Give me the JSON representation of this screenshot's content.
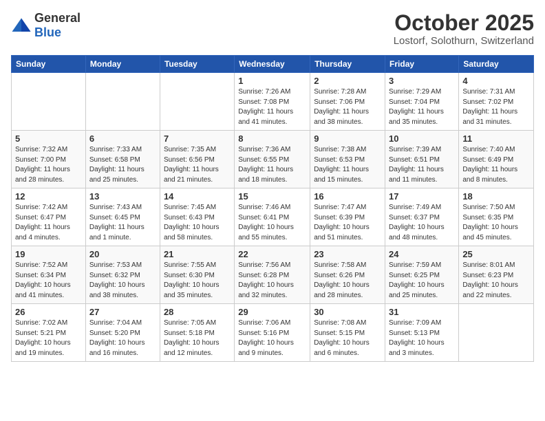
{
  "header": {
    "logo": {
      "general": "General",
      "blue": "Blue"
    },
    "title": "October 2025",
    "location": "Lostorf, Solothurn, Switzerland"
  },
  "weekdays": [
    "Sunday",
    "Monday",
    "Tuesday",
    "Wednesday",
    "Thursday",
    "Friday",
    "Saturday"
  ],
  "weeks": [
    [
      null,
      null,
      null,
      {
        "day": "1",
        "sunrise": "7:26 AM",
        "sunset": "7:08 PM",
        "daylight": "11 hours and 41 minutes."
      },
      {
        "day": "2",
        "sunrise": "7:28 AM",
        "sunset": "7:06 PM",
        "daylight": "11 hours and 38 minutes."
      },
      {
        "day": "3",
        "sunrise": "7:29 AM",
        "sunset": "7:04 PM",
        "daylight": "11 hours and 35 minutes."
      },
      {
        "day": "4",
        "sunrise": "7:31 AM",
        "sunset": "7:02 PM",
        "daylight": "11 hours and 31 minutes."
      }
    ],
    [
      {
        "day": "5",
        "sunrise": "7:32 AM",
        "sunset": "7:00 PM",
        "daylight": "11 hours and 28 minutes."
      },
      {
        "day": "6",
        "sunrise": "7:33 AM",
        "sunset": "6:58 PM",
        "daylight": "11 hours and 25 minutes."
      },
      {
        "day": "7",
        "sunrise": "7:35 AM",
        "sunset": "6:56 PM",
        "daylight": "11 hours and 21 minutes."
      },
      {
        "day": "8",
        "sunrise": "7:36 AM",
        "sunset": "6:55 PM",
        "daylight": "11 hours and 18 minutes."
      },
      {
        "day": "9",
        "sunrise": "7:38 AM",
        "sunset": "6:53 PM",
        "daylight": "11 hours and 15 minutes."
      },
      {
        "day": "10",
        "sunrise": "7:39 AM",
        "sunset": "6:51 PM",
        "daylight": "11 hours and 11 minutes."
      },
      {
        "day": "11",
        "sunrise": "7:40 AM",
        "sunset": "6:49 PM",
        "daylight": "11 hours and 8 minutes."
      }
    ],
    [
      {
        "day": "12",
        "sunrise": "7:42 AM",
        "sunset": "6:47 PM",
        "daylight": "11 hours and 4 minutes."
      },
      {
        "day": "13",
        "sunrise": "7:43 AM",
        "sunset": "6:45 PM",
        "daylight": "11 hours and 1 minute."
      },
      {
        "day": "14",
        "sunrise": "7:45 AM",
        "sunset": "6:43 PM",
        "daylight": "10 hours and 58 minutes."
      },
      {
        "day": "15",
        "sunrise": "7:46 AM",
        "sunset": "6:41 PM",
        "daylight": "10 hours and 55 minutes."
      },
      {
        "day": "16",
        "sunrise": "7:47 AM",
        "sunset": "6:39 PM",
        "daylight": "10 hours and 51 minutes."
      },
      {
        "day": "17",
        "sunrise": "7:49 AM",
        "sunset": "6:37 PM",
        "daylight": "10 hours and 48 minutes."
      },
      {
        "day": "18",
        "sunrise": "7:50 AM",
        "sunset": "6:35 PM",
        "daylight": "10 hours and 45 minutes."
      }
    ],
    [
      {
        "day": "19",
        "sunrise": "7:52 AM",
        "sunset": "6:34 PM",
        "daylight": "10 hours and 41 minutes."
      },
      {
        "day": "20",
        "sunrise": "7:53 AM",
        "sunset": "6:32 PM",
        "daylight": "10 hours and 38 minutes."
      },
      {
        "day": "21",
        "sunrise": "7:55 AM",
        "sunset": "6:30 PM",
        "daylight": "10 hours and 35 minutes."
      },
      {
        "day": "22",
        "sunrise": "7:56 AM",
        "sunset": "6:28 PM",
        "daylight": "10 hours and 32 minutes."
      },
      {
        "day": "23",
        "sunrise": "7:58 AM",
        "sunset": "6:26 PM",
        "daylight": "10 hours and 28 minutes."
      },
      {
        "day": "24",
        "sunrise": "7:59 AM",
        "sunset": "6:25 PM",
        "daylight": "10 hours and 25 minutes."
      },
      {
        "day": "25",
        "sunrise": "8:01 AM",
        "sunset": "6:23 PM",
        "daylight": "10 hours and 22 minutes."
      }
    ],
    [
      {
        "day": "26",
        "sunrise": "7:02 AM",
        "sunset": "5:21 PM",
        "daylight": "10 hours and 19 minutes."
      },
      {
        "day": "27",
        "sunrise": "7:04 AM",
        "sunset": "5:20 PM",
        "daylight": "10 hours and 16 minutes."
      },
      {
        "day": "28",
        "sunrise": "7:05 AM",
        "sunset": "5:18 PM",
        "daylight": "10 hours and 12 minutes."
      },
      {
        "day": "29",
        "sunrise": "7:06 AM",
        "sunset": "5:16 PM",
        "daylight": "10 hours and 9 minutes."
      },
      {
        "day": "30",
        "sunrise": "7:08 AM",
        "sunset": "5:15 PM",
        "daylight": "10 hours and 6 minutes."
      },
      {
        "day": "31",
        "sunrise": "7:09 AM",
        "sunset": "5:13 PM",
        "daylight": "10 hours and 3 minutes."
      },
      null
    ]
  ],
  "labels": {
    "sunrise": "Sunrise:",
    "sunset": "Sunset:",
    "daylight": "Daylight:"
  }
}
